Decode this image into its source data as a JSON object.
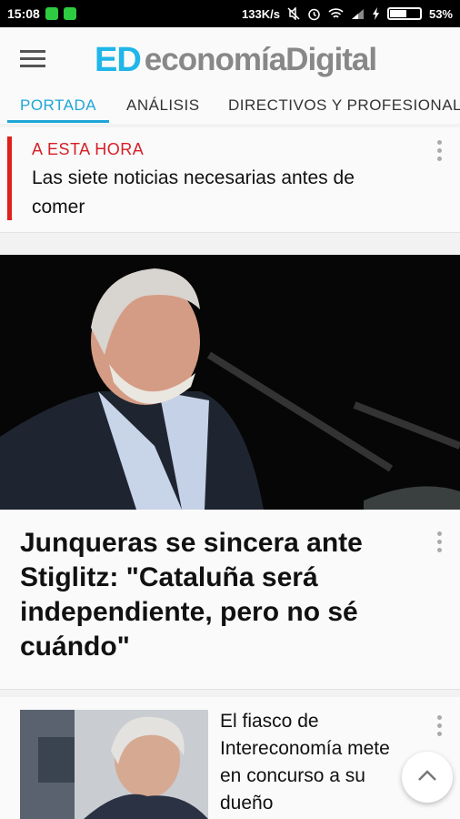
{
  "status_bar": {
    "time": "15:08",
    "network_speed": "133K/s",
    "battery_percent": "53%",
    "battery_level": 0.53
  },
  "header": {
    "logo_ed": "ED",
    "logo_word": "economíaDigital"
  },
  "tabs": [
    {
      "label": "PORTADA",
      "active": true
    },
    {
      "label": "ANÁLISIS",
      "active": false
    },
    {
      "label": "DIRECTIVOS Y PROFESIONALES",
      "active": false
    }
  ],
  "breaking": {
    "kicker": "A ESTA HORA",
    "title": "Las siete noticias necesarias antes de comer"
  },
  "main_article": {
    "title": "Junqueras se sincera ante Stiglitz: \"Cataluña será independiente, pero no sé cuándo\""
  },
  "second_article": {
    "title": "El fiasco de Intereconomía mete en concurso a su dueño"
  },
  "colors": {
    "accent": "#1fa5d6",
    "logo_blue": "#1fb6e8",
    "breaking_red": "#e0201b"
  },
  "icons": [
    "menu-icon",
    "more-vert-icon",
    "chevron-up-icon",
    "wifi-icon",
    "alarm-icon",
    "mute-icon",
    "signal-icon",
    "battery-icon"
  ]
}
